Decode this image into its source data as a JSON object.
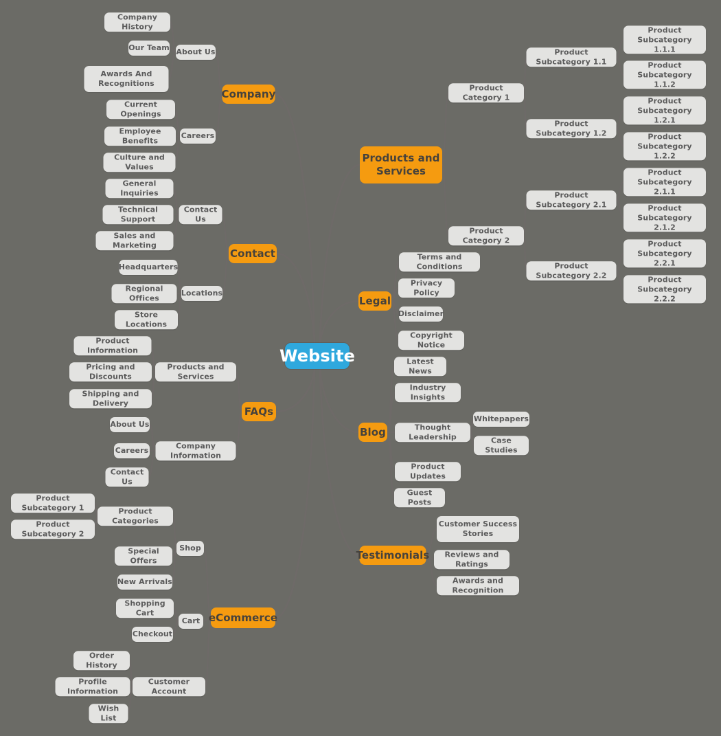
{
  "diagram": {
    "type": "mind-map",
    "title": "Website",
    "background_color": "#6b6b66",
    "root_color": "#2fa8dd",
    "branch_color": "#f59b10",
    "leaf_color": "#e3e3e1",
    "link_color": "#6e6a68"
  },
  "nodes": {
    "root": {
      "label": "Website"
    },
    "company": {
      "label": "Company"
    },
    "about_us": {
      "label": "About Us"
    },
    "company_history": {
      "label": "Company History"
    },
    "our_team": {
      "label": "Our Team"
    },
    "awards_and_recognitions": {
      "label": "Awards And\nRecognitions"
    },
    "careers": {
      "label": "Careers"
    },
    "current_openings": {
      "label": "Current Openings"
    },
    "employee_benefits": {
      "label": "Employee Benefits"
    },
    "culture_and_values": {
      "label": "Culture and Values"
    },
    "contact": {
      "label": "Contact"
    },
    "contact_us": {
      "label": "Contact Us"
    },
    "general_inquiries": {
      "label": "General Inquiries"
    },
    "technical_support": {
      "label": "Technical Support"
    },
    "sales_and_marketing": {
      "label": "Sales and Marketing"
    },
    "locations": {
      "label": "Locations"
    },
    "headquarters": {
      "label": "Headquarters"
    },
    "regional_offices": {
      "label": "Regional Offices"
    },
    "store_locations": {
      "label": "Store Locations"
    },
    "faqs": {
      "label": "FAQs"
    },
    "faq_products_and_services": {
      "label": "Products and Services"
    },
    "product_information": {
      "label": "Product Information"
    },
    "pricing_and_discounts": {
      "label": "Pricing and Discounts"
    },
    "shipping_and_delivery": {
      "label": "Shipping and Delivery"
    },
    "company_information": {
      "label": "Company Information"
    },
    "faq_about_us": {
      "label": "About Us"
    },
    "faq_careers": {
      "label": "Careers"
    },
    "faq_contact_us": {
      "label": "Contact Us"
    },
    "ecommerce": {
      "label": "eCommerce"
    },
    "shop": {
      "label": "Shop"
    },
    "product_categories": {
      "label": "Product Categories"
    },
    "product_subcategory_1": {
      "label": "Product Subcategory 1"
    },
    "product_subcategory_2": {
      "label": "Product Subcategory 2"
    },
    "special_offers": {
      "label": "Special Offers"
    },
    "new_arrivals": {
      "label": "New Arrivals"
    },
    "cart": {
      "label": "Cart"
    },
    "shopping_cart": {
      "label": "Shopping Cart"
    },
    "checkout": {
      "label": "Checkout"
    },
    "customer_account": {
      "label": "Customer Account"
    },
    "order_history": {
      "label": "Order History"
    },
    "profile_information": {
      "label": "Profile Information"
    },
    "wish_list": {
      "label": "Wish List"
    },
    "products_and_services": {
      "label": "Products and\nServices"
    },
    "product_category_1": {
      "label": "Product Category 1"
    },
    "product_subcategory_1_1": {
      "label": "Product Subcategory 1.1"
    },
    "product_subcategory_1_1_1": {
      "label": "Product Subcategory\n1.1.1"
    },
    "product_subcategory_1_1_2": {
      "label": "Product Subcategory\n1.1.2"
    },
    "product_subcategory_1_2": {
      "label": "Product Subcategory 1.2"
    },
    "product_subcategory_1_2_1": {
      "label": "Product Subcategory\n1.2.1"
    },
    "product_subcategory_1_2_2": {
      "label": "Product Subcategory\n1.2.2"
    },
    "product_category_2": {
      "label": "Product Category 2"
    },
    "product_subcategory_2_1": {
      "label": "Product Subcategory 2.1"
    },
    "product_subcategory_2_1_1": {
      "label": "Product Subcategory\n2.1.1"
    },
    "product_subcategory_2_1_2": {
      "label": "Product Subcategory\n2.1.2"
    },
    "product_subcategory_2_2": {
      "label": "Product Subcategory 2.2"
    },
    "product_subcategory_2_2_1": {
      "label": "Product Subcategory\n2.2.1"
    },
    "product_subcategory_2_2_2": {
      "label": "Product Subcategory\n2.2.2"
    },
    "legal": {
      "label": "Legal"
    },
    "terms_and_conditions": {
      "label": "Terms and Conditions"
    },
    "privacy_policy": {
      "label": "Privacy Policy"
    },
    "disclaimer": {
      "label": "Disclaimer"
    },
    "copyright_notice": {
      "label": "Copyright Notice"
    },
    "blog": {
      "label": "Blog"
    },
    "latest_news": {
      "label": "Latest News"
    },
    "industry_insights": {
      "label": "Industry Insights"
    },
    "thought_leadership": {
      "label": "Thought Leadership"
    },
    "whitepapers": {
      "label": "Whitepapers"
    },
    "case_studies": {
      "label": "Case Studies"
    },
    "product_updates": {
      "label": "Product Updates"
    },
    "guest_posts": {
      "label": "Guest Posts"
    },
    "testimonials": {
      "label": "Testimonials"
    },
    "customer_success_stories": {
      "label": "Customer Success\nStories"
    },
    "reviews_and_ratings": {
      "label": "Reviews and Ratings"
    },
    "awards_and_recognition": {
      "label": "Awards and Recognition"
    }
  }
}
